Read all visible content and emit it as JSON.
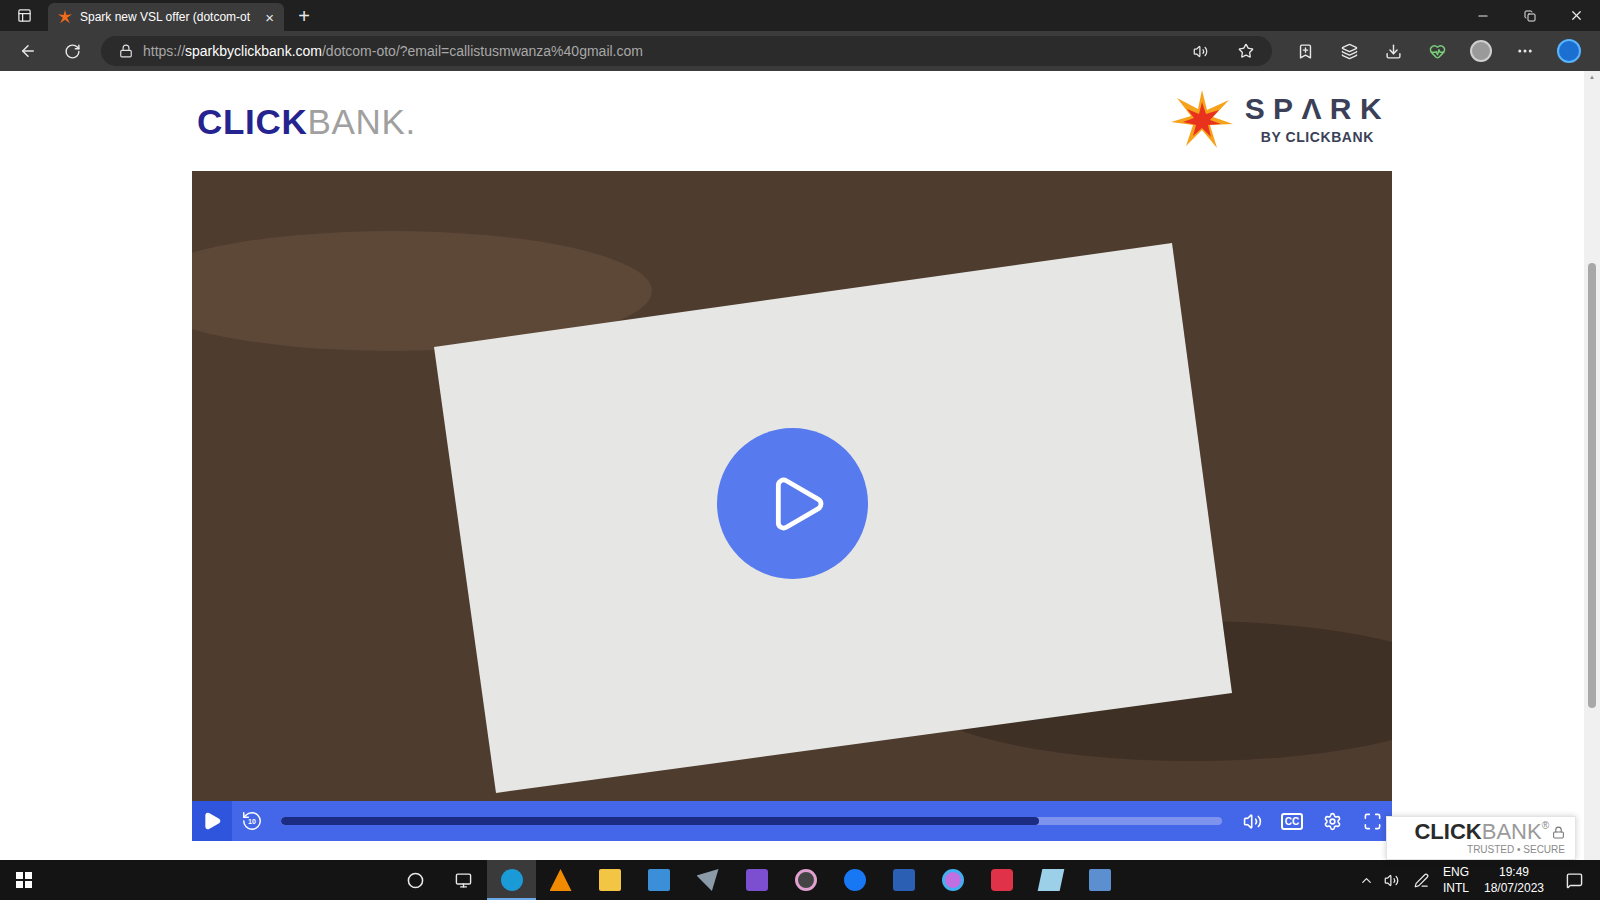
{
  "window": {
    "tab_title": "Spark new VSL offer (dotcom-ot",
    "tab_close": "×",
    "new_tab": "+"
  },
  "address_bar": {
    "url_prefix": "https://",
    "url_host": "sparkbyclickbank.com",
    "url_path": "/dotcom-oto/?email=callistusmwanza%40gmail.com"
  },
  "page": {
    "clickbank_logo": {
      "bold": "CLICK",
      "light": "BANK."
    },
    "spark_logo": {
      "title": "SPΛRK",
      "subtitle": "BY CLICKBANK"
    }
  },
  "video": {
    "playing": false,
    "level": 0.805,
    "rewind": "10",
    "cc": "CC"
  },
  "badge": {
    "bold": "CLICK",
    "light": "BANK",
    "mark": "®",
    "subtitle": "TRUSTED • SECURE"
  },
  "taskbar": {
    "apps": [
      {
        "selected": true
      },
      {
        "selected": false
      },
      {
        "selected": false
      },
      {
        "selected": false
      },
      {
        "selected": false
      },
      {
        "selected": false
      },
      {
        "selected": false
      },
      {
        "selected": false
      },
      {
        "selected": false
      },
      {
        "selected": false
      },
      {
        "selected": false
      },
      {
        "selected": false
      },
      {
        "selected": false
      }
    ],
    "language": "ENG",
    "layout": "INTL",
    "time": "19:49",
    "date": "18/07/2023"
  }
}
